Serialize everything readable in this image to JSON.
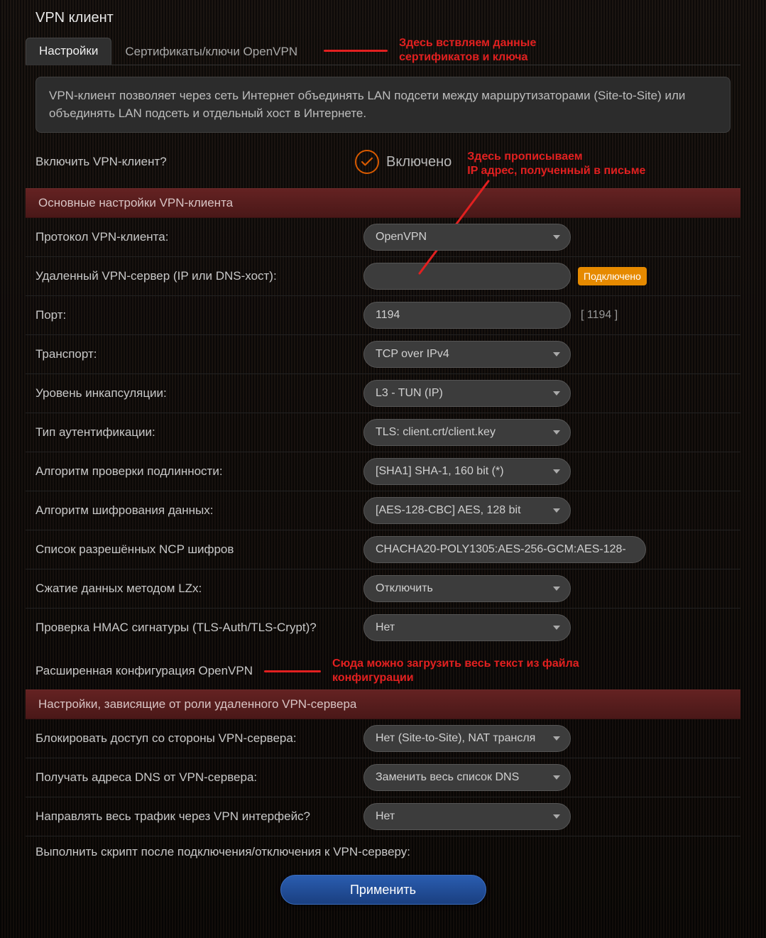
{
  "title": "VPN клиент",
  "tabs": {
    "settings": "Настройки",
    "certs": "Сертификаты/ключи OpenVPN"
  },
  "annotations": {
    "certs": "Здесь вствляем данные сертификатов и ключа",
    "ip": "Здесь прописываем\nIP адрес, полученный в письме",
    "ip_line1": "Здесь прописываем",
    "ip_line2": "IP адрес, полученный в письме",
    "conf": "Сюда можно загрузить весь текст из файла конфигурации",
    "conf_line1": "Сюда можно загрузить весь текст из файла",
    "conf_line2": "конфигурации"
  },
  "description": "VPN-клиент позволяет через сеть Интернет объединять LAN подсети между маршрутизаторами (Site-to-Site) или объединять LAN подсеть и отдельный хост в Интернете.",
  "enable": {
    "label": "Включить VPN-клиент?",
    "status": "Включено"
  },
  "sections": {
    "main": "Основные настройки VPN-клиента",
    "role": "Настройки, зависящие от роли удаленного VPN-сервера"
  },
  "fields": {
    "protocol": {
      "label": "Протокол VPN-клиента:",
      "value": "OpenVPN"
    },
    "remote": {
      "label": "Удаленный VPN-сервер (IP или DNS-хост):",
      "value": "",
      "badge": "Подключено"
    },
    "port": {
      "label": "Порт:",
      "value": "1194",
      "hint": "[ 1194 ]"
    },
    "transport": {
      "label": "Транспорт:",
      "value": "TCP over IPv4"
    },
    "encap": {
      "label": "Уровень инкапсуляции:",
      "value": "L3 - TUN (IP)"
    },
    "auth": {
      "label": "Тип аутентификации:",
      "value": "TLS: client.crt/client.key"
    },
    "hashalg": {
      "label": "Алгоритм проверки подлинности:",
      "value": "[SHA1] SHA-1, 160 bit (*)"
    },
    "cipher": {
      "label": "Алгоритм шифрования данных:",
      "value": "[AES-128-CBC] AES, 128 bit"
    },
    "ncp": {
      "label": "Список разрешённых NCP шифров",
      "value": "CHACHA20-POLY1305:AES-256-GCM:AES-128-"
    },
    "lzo": {
      "label": "Сжатие данных методом LZx:",
      "value": "Отключить"
    },
    "hmac": {
      "label": "Проверка HMAC сигнатуры (TLS-Auth/TLS-Crypt)?",
      "value": "Нет"
    },
    "extconf": {
      "label": "Расширенная конфигурация OpenVPN"
    },
    "block": {
      "label": "Блокировать доступ со стороны VPN-сервера:",
      "value": "Нет (Site-to-Site), NAT трансля"
    },
    "dns": {
      "label": "Получать адреса DNS от VPN-сервера:",
      "value": "Заменить весь список DNS"
    },
    "route": {
      "label": "Направлять весь трафик через VPN интерфейс?",
      "value": "Нет"
    },
    "script": {
      "label": "Выполнить скрипт после подключения/отключения к VPN-серверу:"
    }
  },
  "apply": "Применить"
}
